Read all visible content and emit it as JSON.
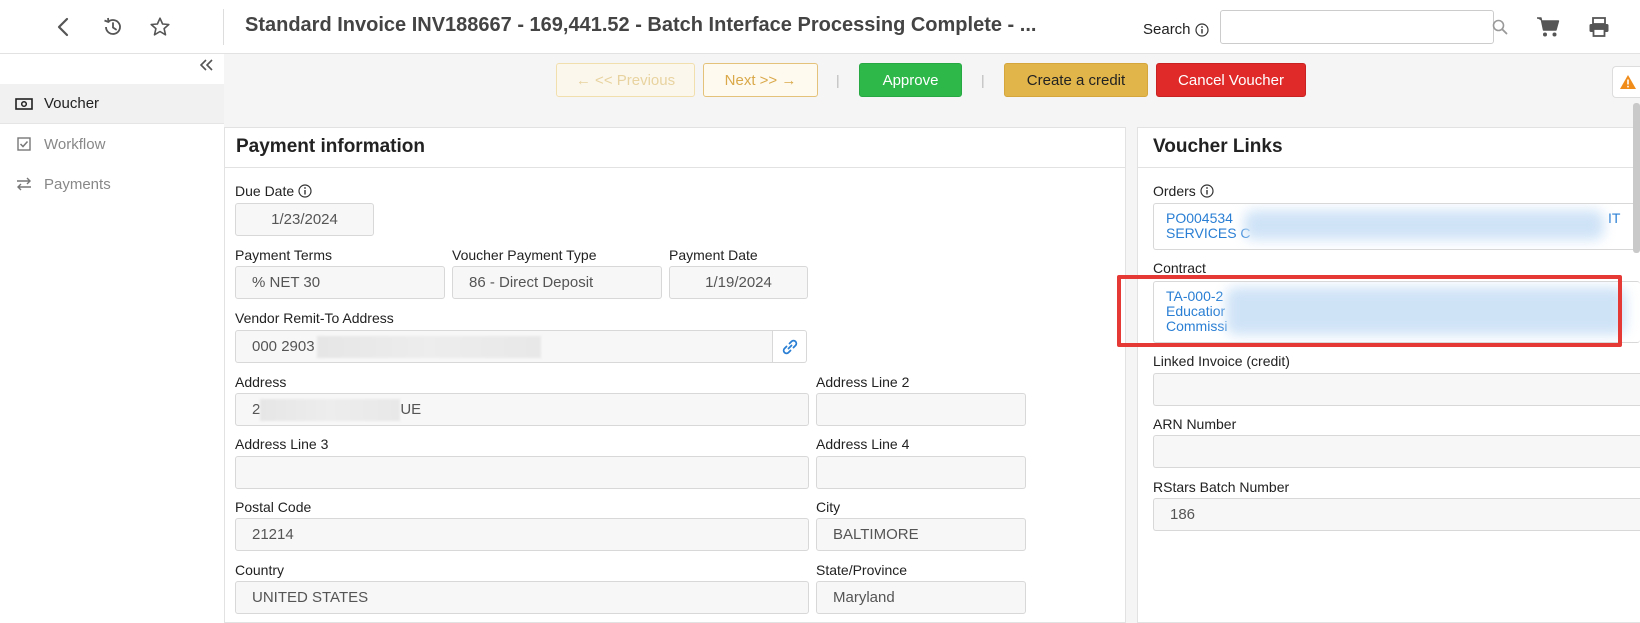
{
  "header": {
    "title": "Standard Invoice INV188667 - 169,441.52 - Batch Interface Processing Complete - ...",
    "search_label": "Search",
    "search_value": ""
  },
  "sidebar": {
    "items": [
      {
        "label": "Voucher",
        "icon": "money-icon"
      },
      {
        "label": "Workflow",
        "icon": "checkbox-icon"
      },
      {
        "label": "Payments",
        "icon": "transfer-icon"
      }
    ]
  },
  "actions": {
    "previous": "← << Previous",
    "next": "Next >> →",
    "approve": "Approve",
    "create_credit": "Create a credit",
    "cancel_voucher": "Cancel Voucher"
  },
  "payment_info": {
    "title": "Payment information",
    "due_date_label": "Due Date",
    "due_date": "1/23/2024",
    "payment_terms_label": "Payment Terms",
    "payment_terms": "% NET 30",
    "voucher_payment_type_label": "Voucher Payment Type",
    "voucher_payment_type": "86 - Direct Deposit",
    "payment_date_label": "Payment Date",
    "payment_date": "1/19/2024",
    "remit_to_label": "Vendor Remit-To Address",
    "remit_to": "000 2903",
    "address_label": "Address",
    "address_prefix": "2",
    "address_suffix": "UE",
    "address2_label": "Address Line 2",
    "address2": "",
    "address3_label": "Address Line 3",
    "address3": "",
    "address4_label": "Address Line 4",
    "address4": "",
    "postal_code_label": "Postal Code",
    "postal_code": "21214",
    "city_label": "City",
    "city": "BALTIMORE",
    "country_label": "Country",
    "country": "UNITED STATES",
    "state_label": "State/Province",
    "state": "Maryland"
  },
  "voucher_links": {
    "title": "Voucher Links",
    "orders_label": "Orders",
    "orders_line1": "PO004534",
    "orders_line1_end": "IT",
    "orders_line2": "SERVICES C",
    "contract_label": "Contract",
    "contract_line1": "TA-000-2",
    "contract_line2": "Educatior",
    "contract_line3": "Commissi",
    "linked_invoice_label": "Linked Invoice (credit)",
    "linked_invoice": "",
    "arn_label": "ARN Number",
    "arn": "",
    "rstars_label": "RStars Batch Number",
    "rstars": "186"
  },
  "colors": {
    "approve": "#2eb84a",
    "create_credit": "#e1b54a",
    "cancel": "#e02a2a",
    "link": "#2a7fd4",
    "highlight": "#e53935"
  }
}
